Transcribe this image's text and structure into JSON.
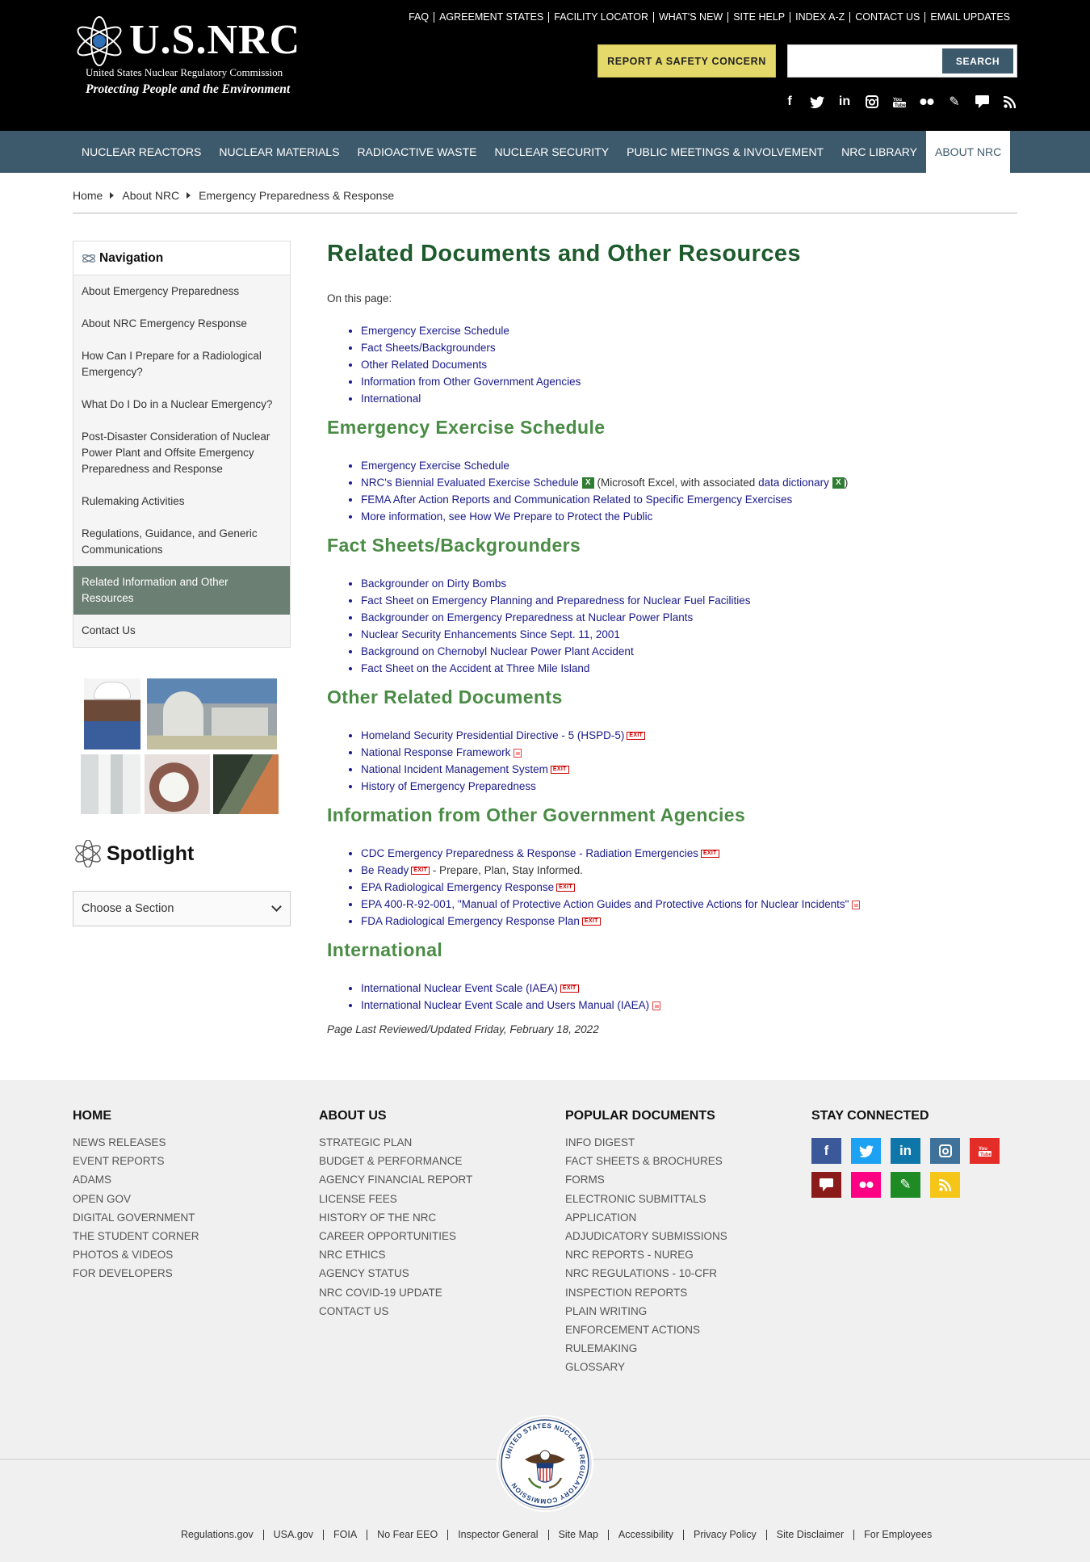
{
  "header": {
    "logo_text": "U.S.NRC",
    "agency": "United States Nuclear Regulatory Commission",
    "tagline": "Protecting People and the Environment",
    "top_links": [
      "FAQ",
      "AGREEMENT STATES",
      "FACILITY LOCATOR",
      "WHAT'S NEW",
      "SITE HELP",
      "INDEX A-Z",
      "CONTACT US",
      "EMAIL UPDATES"
    ],
    "report_button": "REPORT A SAFETY CONCERN",
    "search_placeholder": "",
    "search_button": "SEARCH",
    "social_icons": [
      "facebook-icon",
      "twitter-icon",
      "linkedin-icon",
      "instagram-icon",
      "youtube-icon",
      "flickr-icon",
      "pencil-icon",
      "chat-icon",
      "rss-icon"
    ]
  },
  "nav": {
    "items": [
      "NUCLEAR REACTORS",
      "NUCLEAR MATERIALS",
      "RADIOACTIVE WASTE",
      "NUCLEAR SECURITY",
      "PUBLIC MEETINGS & INVOLVEMENT",
      "NRC LIBRARY",
      "ABOUT NRC"
    ],
    "active": "ABOUT NRC"
  },
  "breadcrumb": [
    "Home",
    "About NRC",
    "Emergency Preparedness & Response"
  ],
  "sidebar": {
    "title": "Navigation",
    "links": [
      "About Emergency Preparedness",
      "About NRC Emergency Response",
      "How Can I Prepare for a Radiological Emergency?",
      "What Do I Do in a Nuclear Emergency?",
      "Post-Disaster Consideration of Nuclear Power Plant and Offsite Emergency Preparedness and Response",
      "Rulemaking Activities",
      "Regulations, Guidance, and Generic Communications",
      "Related Information and Other Resources",
      "Contact Us"
    ],
    "active_index": 7,
    "spotlight_title": "Spotlight",
    "select_value": "Choose a Section"
  },
  "main": {
    "title": "Related Documents and Other Resources",
    "on_this_page": "On this page:",
    "toc": [
      "Emergency Exercise Schedule",
      "Fact Sheets/Backgrounders",
      "Other Related Documents",
      "Information from Other Government Agencies",
      "International"
    ],
    "sections": {
      "exercise": {
        "heading": "Emergency Exercise Schedule",
        "items": {
          "schedule": "Emergency Exercise Schedule",
          "biennial": "NRC's Biennial Evaluated Exercise Schedule",
          "biennial_note_pre": "(Microsoft Excel, with associated ",
          "biennial_dict": "data dictionary",
          "biennial_note_post": ")",
          "fema": "FEMA After Action Reports and Communication Related to Specific Emergency Exercises",
          "more": "More information, see How We Prepare to Protect the Public"
        }
      },
      "fact": {
        "heading": "Fact Sheets/Backgrounders",
        "items": [
          "Backgrounder on Dirty Bombs",
          "Fact Sheet on Emergency Planning and Preparedness for Nuclear Fuel Facilities",
          "Backgrounder on Emergency Preparedness at Nuclear Power Plants",
          "Nuclear Security Enhancements Since Sept. 11, 2001",
          "Background on Chernobyl Nuclear Power Plant Accident",
          "Fact Sheet on the Accident at Three Mile Island"
        ]
      },
      "other": {
        "heading": "Other Related Documents",
        "items": {
          "hspd": "Homeland Security Presidential Directive - 5 (HSPD-5)",
          "nrf": "National Response Framework",
          "nims": "National Incident Management System",
          "history": "History of Emergency Preparedness"
        }
      },
      "gov": {
        "heading": "Information from Other Government Agencies",
        "items": {
          "cdc": "CDC Emergency Preparedness & Response - Radiation Emergencies",
          "ready": "Be Ready",
          "ready_note": " - Prepare, Plan, Stay Informed.",
          "epa": "EPA Radiological Emergency Response",
          "epa400": "EPA 400-R-92-001, \"Manual of Protective Action Guides and Protective Actions for Nuclear Incidents\"",
          "fda": "FDA Radiological Emergency Response Plan"
        }
      },
      "intl": {
        "heading": "International",
        "items": {
          "ines": "International Nuclear Event Scale (IAEA)",
          "manual": "International Nuclear Event Scale and Users Manual (IAEA)"
        }
      }
    },
    "exit_label": "EXIT",
    "xls_label": "X",
    "reviewed": "Page Last Reviewed/Updated Friday, February 18, 2022"
  },
  "footer": {
    "home": {
      "heading": "HOME",
      "links": [
        "NEWS RELEASES",
        "EVENT REPORTS",
        "ADAMS",
        "OPEN GOV",
        "DIGITAL GOVERNMENT",
        "THE STUDENT CORNER",
        "PHOTOS & VIDEOS",
        "FOR DEVELOPERS"
      ]
    },
    "about": {
      "heading": "ABOUT US",
      "links": [
        "STRATEGIC PLAN",
        "BUDGET & PERFORMANCE",
        "AGENCY FINANCIAL REPORT",
        "LICENSE FEES",
        "HISTORY OF THE NRC",
        "CAREER OPPORTUNITIES",
        "NRC ETHICS",
        "AGENCY STATUS",
        "NRC COVID-19 UPDATE",
        "CONTACT US"
      ]
    },
    "popular": {
      "heading": "POPULAR DOCUMENTS",
      "links": [
        "INFO DIGEST",
        "FACT SHEETS & BROCHURES",
        "FORMS",
        "ELECTRONIC SUBMITTALS",
        "APPLICATION",
        "ADJUDICATORY SUBMISSIONS",
        "NRC REPORTS - NUREG",
        "NRC REGULATIONS - 10-CFR",
        "INSPECTION REPORTS",
        "PLAIN WRITING",
        "ENFORCEMENT ACTIONS",
        "RULEMAKING",
        "GLOSSARY"
      ]
    },
    "connect": {
      "heading": "STAY CONNECTED",
      "icons": [
        {
          "name": "facebook-icon",
          "color": "#3b5998",
          "glyph": "f"
        },
        {
          "name": "twitter-icon",
          "color": "#1da1f2",
          "glyph": "t"
        },
        {
          "name": "linkedin-icon",
          "color": "#0e76a8",
          "glyph": "in"
        },
        {
          "name": "instagram-icon",
          "color": "#3f729b",
          "glyph": "◙"
        },
        {
          "name": "youtube-icon",
          "color": "#e52d27",
          "glyph": "▶"
        },
        {
          "name": "chat-icon",
          "color": "#8b1a1a",
          "glyph": "▬"
        },
        {
          "name": "flickr-icon",
          "color": "#ff0084",
          "glyph": "••"
        },
        {
          "name": "pencil-icon",
          "color": "#1f8b24",
          "glyph": "✎"
        },
        {
          "name": "rss-icon",
          "color": "#f5c518",
          "glyph": "◠"
        }
      ]
    },
    "seal_text": "UNITED STATES NUCLEAR REGULATORY COMMISSION",
    "bottom_links": [
      "Regulations.gov",
      "USA.gov",
      "FOIA",
      "No Fear EEO",
      "Inspector General",
      "Site Map",
      "Accessibility",
      "Privacy Policy",
      "Site Disclaimer",
      "For Employees"
    ]
  }
}
